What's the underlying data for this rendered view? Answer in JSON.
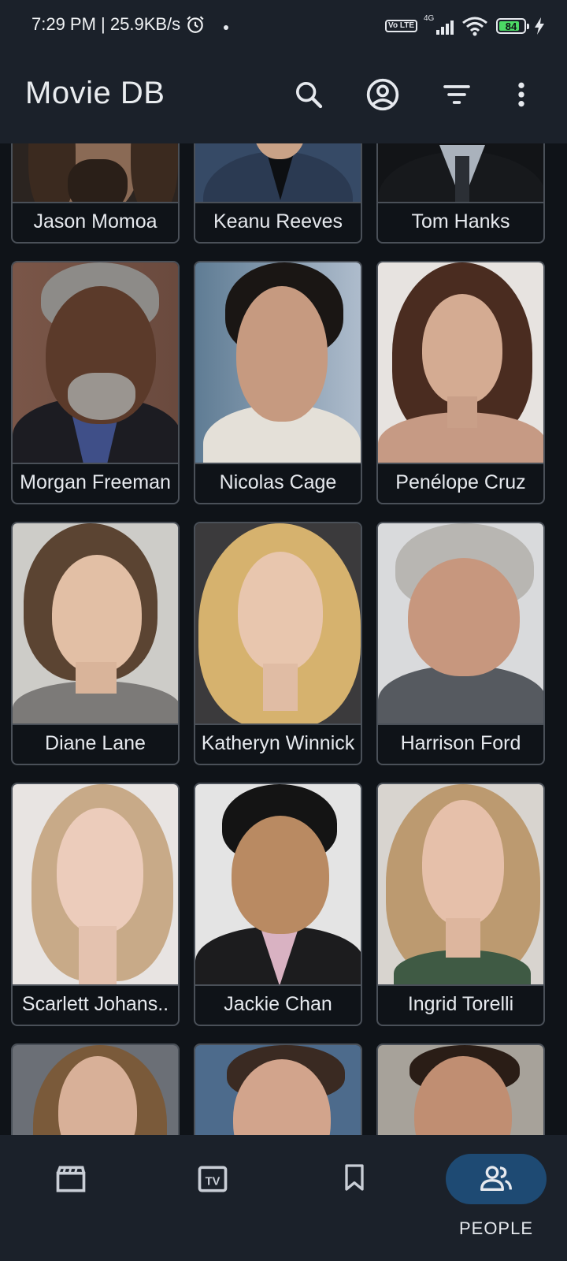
{
  "status_bar": {
    "time_speed": "7:29 PM | 25.9KB/s",
    "network": "4G",
    "volte": "Vo LTE",
    "battery_level": 84,
    "battery_text": "84"
  },
  "app_bar": {
    "title": "Movie DB",
    "actions": [
      "search-icon",
      "account-icon",
      "filter-icon",
      "more-vert-icon"
    ]
  },
  "people": [
    {
      "name": "Jason Momoa"
    },
    {
      "name": "Keanu Reeves"
    },
    {
      "name": "Tom Hanks"
    },
    {
      "name": "Morgan Freeman"
    },
    {
      "name": "Nicolas Cage"
    },
    {
      "name": "Penélope Cruz"
    },
    {
      "name": "Diane Lane"
    },
    {
      "name": "Katheryn Winnick"
    },
    {
      "name": "Harrison Ford"
    },
    {
      "name": "Scarlett Johans.."
    },
    {
      "name": "Jackie Chan"
    },
    {
      "name": "Ingrid Torelli"
    },
    {
      "name": ""
    },
    {
      "name": ""
    },
    {
      "name": ""
    }
  ],
  "bottom_nav": {
    "items": [
      {
        "icon": "movie-clapper-icon",
        "label": ""
      },
      {
        "icon": "tv-icon",
        "label": ""
      },
      {
        "icon": "bookmark-icon",
        "label": ""
      },
      {
        "icon": "people-icon",
        "label": "PEOPLE"
      }
    ],
    "selected_index": 3,
    "selected_color": "#1e4a73"
  },
  "colors": {
    "background": "#0f1318",
    "app_bar": "#1b212a",
    "card_border": "#4a5058",
    "text": "#e6e9ee"
  }
}
